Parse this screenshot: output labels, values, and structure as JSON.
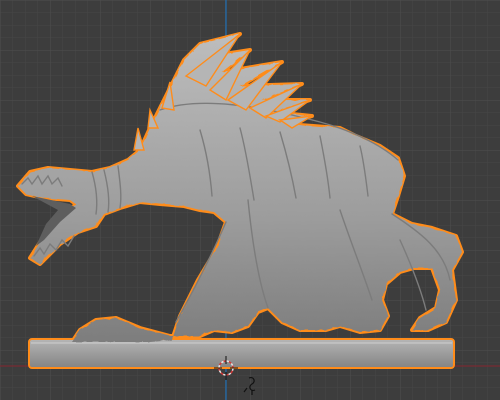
{
  "viewport": {
    "background": "#3d3d3d",
    "grid_minor_color": "#464646",
    "grid_major_color": "#4f4f4f",
    "x_axis_color": "#7a2b33",
    "y_axis_color": "#1f6fb5",
    "selection_outline_color": "#ff8c1a",
    "mesh_color": "#a9a9a9"
  },
  "scene": {
    "selected_object": "creature-sculpt-on-base",
    "base_shape": "rounded rectangular plinth",
    "origin_icon": "3d-cursor-icon",
    "light_icon": "light-icon"
  }
}
